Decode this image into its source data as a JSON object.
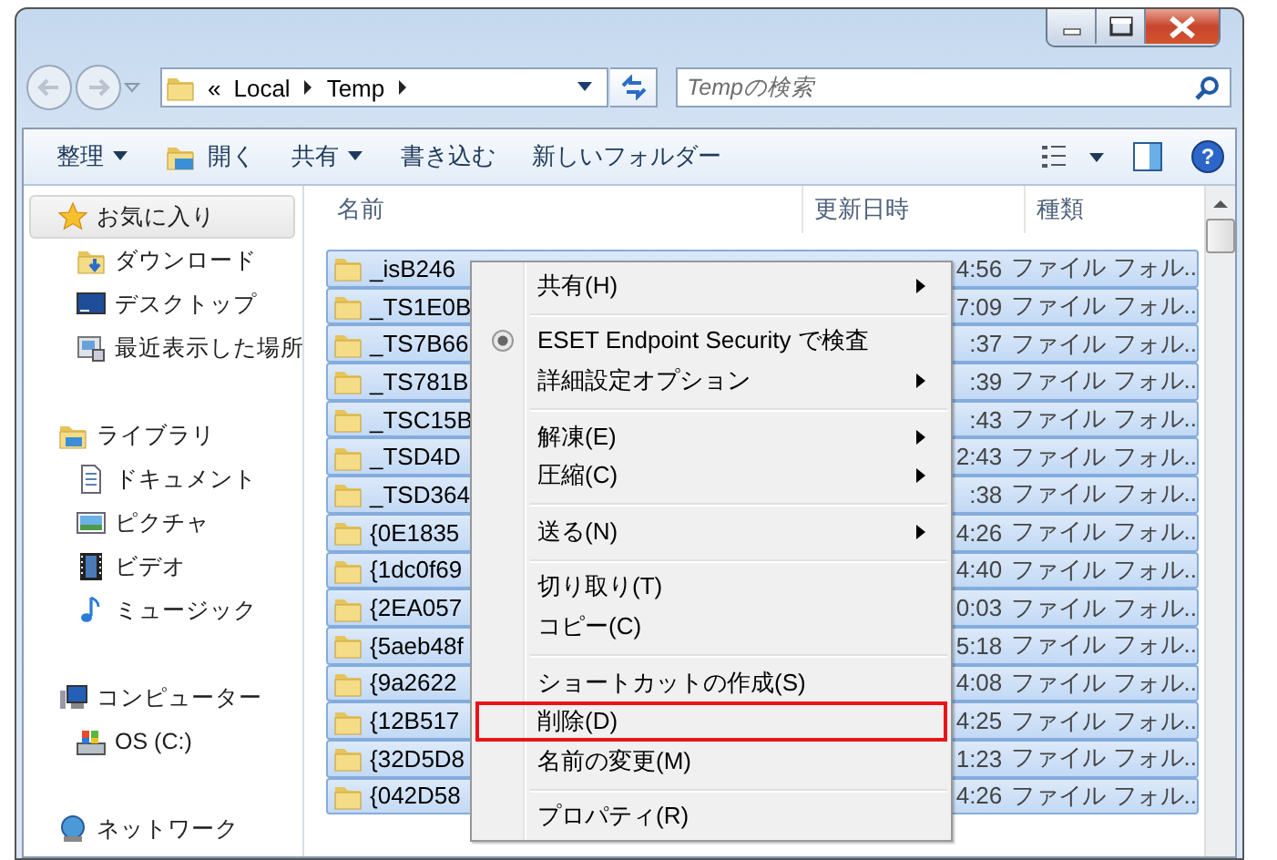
{
  "address_bar": {
    "overflow": "«",
    "crumbs": [
      "Local",
      "Temp"
    ]
  },
  "search": {
    "placeholder": "Tempの検索"
  },
  "toolbar": {
    "items": [
      {
        "label": "整理",
        "dropdown": true,
        "kind": "menu"
      },
      {
        "label": "開く",
        "dropdown": false,
        "kind": "open"
      },
      {
        "label": "共有",
        "dropdown": true,
        "kind": "menu"
      },
      {
        "label": "書き込む",
        "dropdown": false,
        "kind": "plain"
      },
      {
        "label": "新しいフォルダー",
        "dropdown": false,
        "kind": "plain"
      }
    ],
    "help": "?"
  },
  "sidebar": {
    "groups": [
      {
        "label": "お気に入り",
        "kind": "favorites",
        "selected": true,
        "children": [
          {
            "label": "ダウンロード",
            "kind": "downloads",
            "selected": false
          },
          {
            "label": "デスクトップ",
            "kind": "desktop",
            "selected": false
          },
          {
            "label": "最近表示した場所",
            "kind": "recent",
            "selected": false
          }
        ]
      },
      {
        "label": "ライブラリ",
        "kind": "libraries",
        "selected": false,
        "children": [
          {
            "label": "ドキュメント",
            "kind": "documents",
            "selected": false
          },
          {
            "label": "ピクチャ",
            "kind": "pictures",
            "selected": false
          },
          {
            "label": "ビデオ",
            "kind": "videos",
            "selected": false
          },
          {
            "label": "ミュージック",
            "kind": "music",
            "selected": false
          }
        ]
      },
      {
        "label": "コンピューター",
        "kind": "computer",
        "selected": false,
        "children": [
          {
            "label": "OS (C:)",
            "kind": "drive",
            "selected": false
          }
        ]
      },
      {
        "label": "ネットワーク",
        "kind": "network",
        "selected": false
      }
    ]
  },
  "table": {
    "columns": [
      "名前",
      "更新日時",
      "種類"
    ],
    "rows": [
      {
        "name": "_isB246",
        "modified": "4:56",
        "type": "ファイル フォル..",
        "selected": true
      },
      {
        "name": "_TS1E0B",
        "modified": "7:09",
        "type": "ファイル フォル..",
        "selected": true
      },
      {
        "name": "_TS7B66",
        "modified": ":37",
        "type": "ファイル フォル..",
        "selected": true
      },
      {
        "name": "_TS781B",
        "modified": ":39",
        "type": "ファイル フォル..",
        "selected": true
      },
      {
        "name": "_TSC15B",
        "modified": ":43",
        "type": "ファイル フォル..",
        "selected": true
      },
      {
        "name": "_TSD4D",
        "modified": "2:43",
        "type": "ファイル フォル..",
        "selected": true
      },
      {
        "name": "_TSD364",
        "modified": ":38",
        "type": "ファイル フォル..",
        "selected": true
      },
      {
        "name": "{0E1835",
        "modified": "4:26",
        "type": "ファイル フォル..",
        "selected": true
      },
      {
        "name": "{1dc0f69",
        "modified": "4:40",
        "type": "ファイル フォル..",
        "selected": true
      },
      {
        "name": "{2EA057",
        "modified": "0:03",
        "type": "ファイル フォル..",
        "selected": true
      },
      {
        "name": "{5aeb48f",
        "modified": "5:18",
        "type": "ファイル フォル..",
        "selected": true
      },
      {
        "name": "{9a2622",
        "modified": "4:08",
        "type": "ファイル フォル..",
        "selected": true
      },
      {
        "name": "{12B517",
        "modified": "4:25",
        "type": "ファイル フォル..",
        "selected": true
      },
      {
        "name": "{32D5D8",
        "modified": "1:23",
        "type": "ファイル フォル..",
        "selected": true
      },
      {
        "name": "{042D58",
        "modified": "4:26",
        "type": "ファイル フォル..",
        "selected": true
      }
    ]
  },
  "context_menu": {
    "items": [
      {
        "kind": "item",
        "label": "共有(H)",
        "submenu": true,
        "highlighted": false
      },
      {
        "kind": "separator"
      },
      {
        "kind": "scan",
        "label": "ESET Endpoint Security で検査",
        "submenu": false,
        "highlighted": false
      },
      {
        "kind": "item",
        "label": "詳細設定オプション",
        "submenu": true,
        "highlighted": false
      },
      {
        "kind": "separator"
      },
      {
        "kind": "item",
        "label": "解凍(E)",
        "submenu": true,
        "highlighted": false
      },
      {
        "kind": "item",
        "label": "圧縮(C)",
        "submenu": true,
        "highlighted": false
      },
      {
        "kind": "separator"
      },
      {
        "kind": "item",
        "label": "送る(N)",
        "submenu": true,
        "highlighted": false
      },
      {
        "kind": "separator"
      },
      {
        "kind": "item",
        "label": "切り取り(T)",
        "submenu": false,
        "highlighted": false
      },
      {
        "kind": "item",
        "label": "コピー(C)",
        "submenu": false,
        "highlighted": false
      },
      {
        "kind": "separator"
      },
      {
        "kind": "item",
        "label": "ショートカットの作成(S)",
        "submenu": false,
        "highlighted": false
      },
      {
        "kind": "item",
        "label": "削除(D)",
        "submenu": false,
        "highlighted": true
      },
      {
        "kind": "item",
        "label": "名前の変更(M)",
        "submenu": false,
        "highlighted": false
      },
      {
        "kind": "separator"
      },
      {
        "kind": "item",
        "label": "プロパティ(R)",
        "submenu": false,
        "highlighted": false
      }
    ]
  }
}
